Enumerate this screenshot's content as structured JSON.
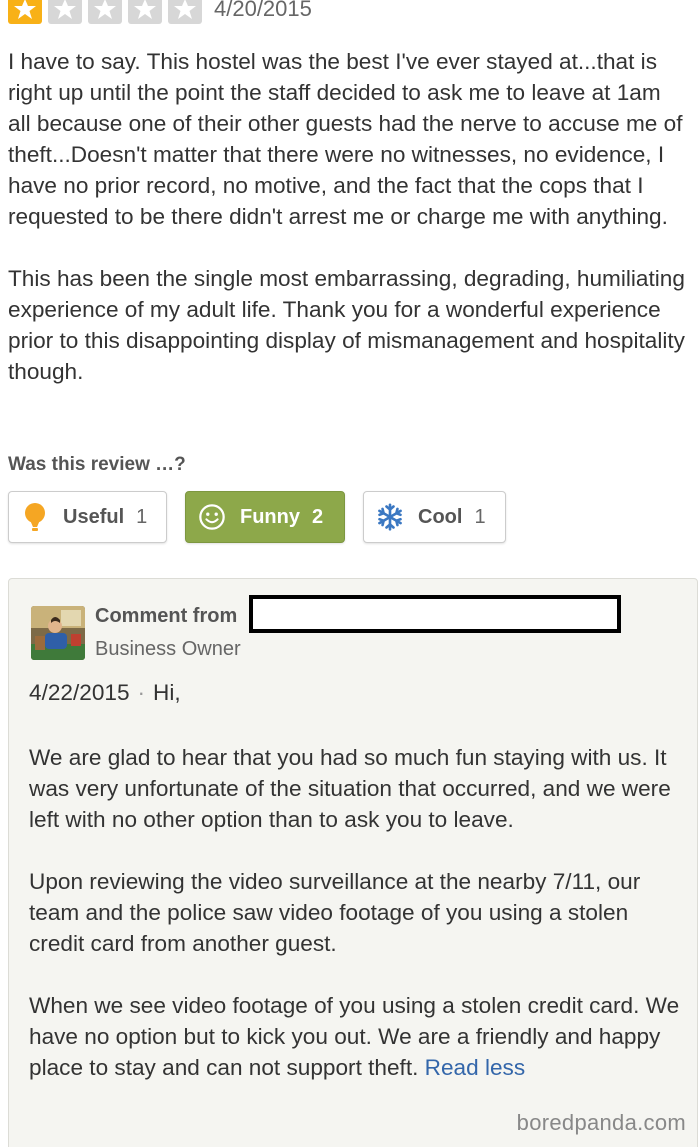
{
  "review": {
    "rating": 1,
    "rating_max": 5,
    "date": "4/20/2015",
    "paragraphs": [
      "I have to say.  This hostel was the best I've ever stayed at...that is right up until the point the staff decided to ask me to leave at 1am all because one of their other guests had the nerve to accuse me of theft...Doesn't matter that there were no witnesses, no evidence, I have no prior record, no motive, and the fact that the cops that I requested to be there didn't arrest me or charge me with anything.",
      "This has been the single most embarrassing, degrading, humiliating experience of my adult life.  Thank you for a wonderful experience prior to this disappointing display of mismanagement and hospitality though."
    ]
  },
  "votes": {
    "label": "Was this review …?",
    "useful": {
      "label": "Useful",
      "count": "1",
      "icon": "lightbulb-icon"
    },
    "funny": {
      "label": "Funny",
      "count": "2",
      "icon": "smiley-icon"
    },
    "cool": {
      "label": "Cool",
      "count": "1",
      "icon": "snowflake-icon"
    }
  },
  "comment": {
    "from_label": "Comment from",
    "role": "Business Owner",
    "date": "4/22/2015",
    "greeting": "Hi,",
    "paragraphs": [
      "We are glad to hear that you had so much fun staying with us. It was very unfortunate of the situation that occurred, and we were left with no other option than to ask you to leave.",
      "Upon reviewing the video surveillance at the nearby 7/11, our team and the police saw video footage of you using a stolen credit card from another guest."
    ],
    "last_paragraph": "When we see video footage of you using a stolen credit card. We have no option but to kick you out. We are a friendly and happy place to stay and can not support theft.",
    "read_less": "Read less"
  },
  "watermark": "boredpanda.com",
  "colors": {
    "star_filled": "#f8b117",
    "star_empty": "#d7d7d7",
    "funny_active": "#8da84a",
    "useful_icon": "#f5a623",
    "cool_icon": "#3b78c2",
    "link": "#3366aa"
  }
}
